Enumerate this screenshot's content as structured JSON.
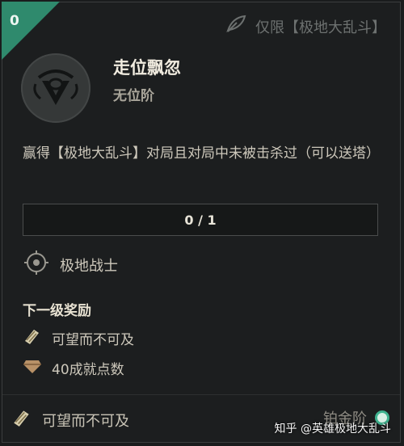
{
  "badge": {
    "count": "0",
    "color": "#2f8a6d"
  },
  "mode_tag": {
    "icon": "feather-icon",
    "label": "仅限【极地大乱斗】"
  },
  "emblem_icon": "challenge-emblem-icon",
  "challenge": {
    "title": "走位飘忽",
    "tier": "无位阶",
    "description": "赢得【极地大乱斗】对局且对局中未被击杀过（可以送塔）"
  },
  "progress": {
    "text": "0 / 1",
    "current": 0,
    "target": 1
  },
  "category": {
    "icon": "target-ring-icon",
    "label": "极地战士"
  },
  "next_reward": {
    "heading": "下一级奖励",
    "items": [
      {
        "icon": "scroll-icon",
        "label": "可望而不可及"
      },
      {
        "icon": "diamond-icon",
        "label": "40成就点数"
      }
    ]
  },
  "footer": {
    "title_icon": "scroll-icon",
    "title_label": "可望而不可及",
    "rank_label": "铂金阶",
    "rank_icon": "platinum-rank-icon"
  },
  "watermark": "知乎 @英雄极地大乱斗"
}
